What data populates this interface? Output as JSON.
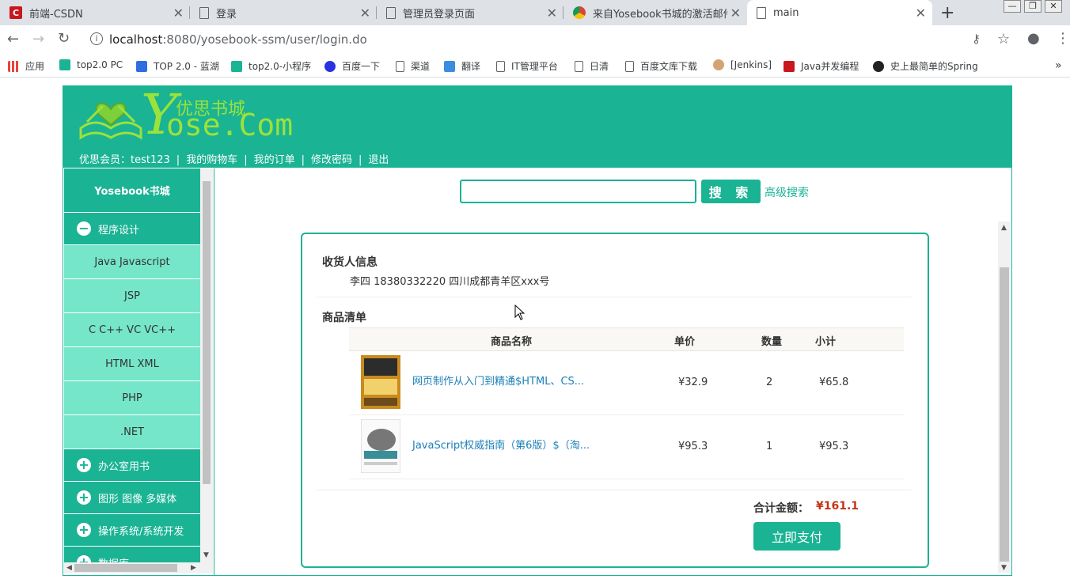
{
  "tabs": [
    {
      "label": "前端-CSDN",
      "icon": "csdn-icon"
    },
    {
      "label": "登录",
      "icon": "document-icon"
    },
    {
      "label": "管理员登录页面",
      "icon": "document-icon"
    },
    {
      "label": "来自Yosebook书城的激活邮件",
      "icon": "chrome-icon"
    },
    {
      "label": "main",
      "icon": "document-icon",
      "active": true
    }
  ],
  "address": {
    "host": "localhost",
    "rest": ":8080/yosebook-ssm/user/login.do"
  },
  "bookmarks": [
    {
      "label": "应用",
      "color": "#e8453c"
    },
    {
      "label": "top2.0 PC",
      "color": "#1ab394"
    },
    {
      "label": "TOP 2.0 - 蓝湖",
      "color": "#2f6ee0"
    },
    {
      "label": "top2.0-小程序",
      "color": "#1ab394"
    },
    {
      "label": "百度一下",
      "color": "#2932e1"
    },
    {
      "label": "渠道",
      "color": "#ffffff"
    },
    {
      "label": "翻译",
      "color": "#3b8ddf"
    },
    {
      "label": "IT管理平台",
      "color": "#ffffff"
    },
    {
      "label": "日清",
      "color": "#ffffff"
    },
    {
      "label": "百度文库下载",
      "color": "#ffffff"
    },
    {
      "label": "[Jenkins]",
      "color": "#d4a373"
    },
    {
      "label": "Java并发编程",
      "color": "#c8171e"
    },
    {
      "label": "史上最简单的Spring",
      "color": "#222222"
    }
  ],
  "logo": {
    "cn": "优思书城",
    "y": "Y",
    "ose": "ose.Com"
  },
  "topnav": {
    "member_prefix": "优思会员：",
    "username": "test123",
    "cart": "我的购物车",
    "orders": "我的订单",
    "password": "修改密码",
    "logout": "退出",
    "sep": "|"
  },
  "sidebar": {
    "title": "Yosebook书城",
    "expanded": {
      "label": "程序设计",
      "icon_text": "−"
    },
    "subitems": [
      "Java Javascript",
      "JSP",
      "C C++ VC VC++",
      "HTML XML",
      "PHP",
      ".NET"
    ],
    "categories": [
      "办公室用书",
      "图形 图像 多媒体",
      "操作系统/系统开发",
      "数据库"
    ],
    "plus_text": "+"
  },
  "search": {
    "value": "",
    "button": "搜 索",
    "advanced": "高级搜索"
  },
  "order": {
    "receiver_title": "收货人信息",
    "receiver": "李四 18380332220 四川成都青羊区xxx号",
    "list_title": "商品清单",
    "columns": [
      "商品名称",
      "单价",
      "数量",
      "小计"
    ],
    "items": [
      {
        "name": "网页制作从入门到精通$HTML、CS...",
        "price": "¥32.9",
        "qty": "2",
        "subtotal": "¥65.8"
      },
      {
        "name": "JavaScript权威指南（第6版）$（淘...",
        "price": "¥95.3",
        "qty": "1",
        "subtotal": "¥95.3"
      }
    ],
    "total_label": "合计金额：",
    "total": "¥161.1",
    "pay_button": "立即支付"
  },
  "colors": {
    "brand": "#1ab394",
    "sub_bg": "#75e6c9",
    "price_red": "#c23616",
    "link": "#1a7fb8"
  }
}
